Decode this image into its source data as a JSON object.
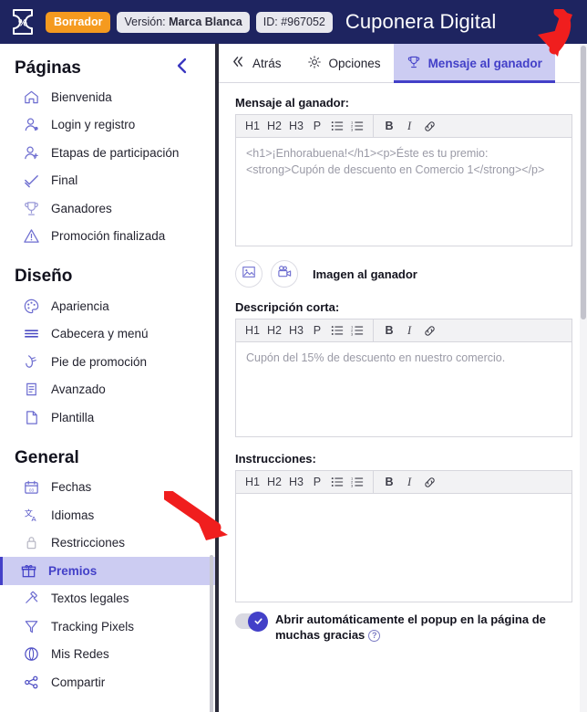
{
  "header": {
    "logo_icon": "coupon-ticket-percent-icon",
    "status_badge": "Borrador",
    "version_prefix": "Versión:",
    "version_value": "Marca Blanca",
    "id_label": "ID: #967052",
    "title": "Cuponera Digital",
    "bg_color": "#1e2460",
    "badge_color": "#f59a1f"
  },
  "sidebar": {
    "title": "Páginas",
    "collapse_icon": "chevron-left-icon",
    "groups": [
      {
        "title": "Páginas",
        "items": [
          {
            "label": "Bienvenida",
            "icon": "home-icon"
          },
          {
            "label": "Login y registro",
            "icon": "user-login-icon"
          },
          {
            "label": "Etapas de participación",
            "icon": "user-add-icon"
          },
          {
            "label": "Final",
            "icon": "check-icon"
          },
          {
            "label": "Ganadores",
            "icon": "trophy-icon"
          },
          {
            "label": "Promoción finalizada",
            "icon": "warning-triangle-icon"
          }
        ]
      },
      {
        "title": "Diseño",
        "items": [
          {
            "label": "Apariencia",
            "icon": "palette-icon"
          },
          {
            "label": "Cabecera y menú",
            "icon": "menu-lines-icon"
          },
          {
            "label": "Pie de promoción",
            "icon": "footer-icon"
          },
          {
            "label": "Avanzado",
            "icon": "scroll-document-icon"
          },
          {
            "label": "Plantilla",
            "icon": "page-icon"
          }
        ]
      },
      {
        "title": "General",
        "items": [
          {
            "label": "Fechas",
            "icon": "calendar-icon"
          },
          {
            "label": "Idiomas",
            "icon": "translate-icon"
          },
          {
            "label": "Restricciones",
            "icon": "lock-icon"
          },
          {
            "label": "Premios",
            "icon": "gift-icon",
            "active": true
          },
          {
            "label": "Textos legales",
            "icon": "gavel-icon"
          },
          {
            "label": "Tracking Pixels",
            "icon": "funnel-icon"
          },
          {
            "label": "Mis Redes",
            "icon": "network-globe-icon"
          },
          {
            "label": "Compartir",
            "icon": "share-icon"
          }
        ]
      }
    ],
    "active_color": "#4340c8",
    "active_bg": "#ccccf2"
  },
  "tabs": [
    {
      "label": "Atrás",
      "icon": "double-chevron-left-icon",
      "active": false
    },
    {
      "label": "Opciones",
      "icon": "gear-icon",
      "active": false
    },
    {
      "label": "Mensaje al ganador",
      "icon": "trophy-icon",
      "active": true
    }
  ],
  "toolbar_buttons": [
    "H1",
    "H2",
    "H3",
    "P",
    "bullet-list-icon",
    "numbered-list-icon",
    "B",
    "I",
    "link-icon"
  ],
  "sections": {
    "winner_message": {
      "label": "Mensaje al ganador:",
      "value": "<h1>¡Enhorabuena!</h1><p>Éste es tu premio: <strong>Cupón de descuento en Comercio 1</strong></p>"
    },
    "media": {
      "image_icon": "image-icon",
      "video_icon": "video-camera-icon",
      "label": "Imagen al ganador"
    },
    "short_description": {
      "label": "Descripción corta:",
      "value": "Cupón del 15% de descuento en nuestro comercio."
    },
    "instructions": {
      "label": "Instrucciones:",
      "value": ""
    }
  },
  "toggle": {
    "label": "Abrir automáticamente el popup en la página de muchas gracias",
    "checked": true,
    "help_icon": "question-mark-icon",
    "help_char": "?"
  },
  "annotations": [
    {
      "name": "arrow-to-winner-message-tab",
      "color": "#f01e1e"
    },
    {
      "name": "arrow-to-instructions-editor",
      "color": "#f01e1e"
    }
  ]
}
